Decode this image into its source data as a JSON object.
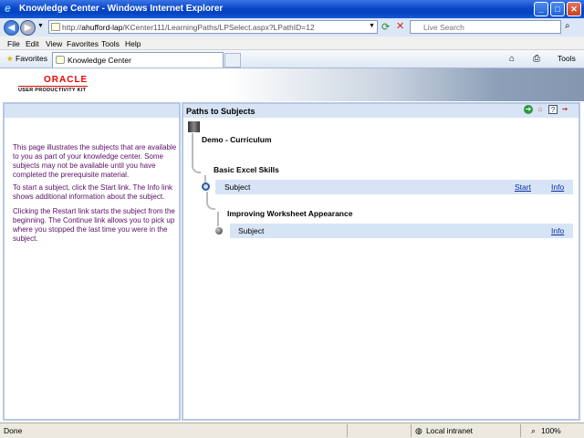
{
  "window": {
    "title": "Knowledge Center - Windows Internet Explorer"
  },
  "addressbar": {
    "url_prefix": "http://",
    "url_host": "ahufford-lap",
    "url_path": "/KCenter111/LearningPaths/LPSelect.aspx?LPathID=12",
    "search_placeholder": "Live Search"
  },
  "menu": [
    "File",
    "Edit",
    "View",
    "Favorites",
    "Tools",
    "Help"
  ],
  "favbar": {
    "favorites": "Favorites",
    "tab": "Knowledge Center",
    "tools": "Tools"
  },
  "banner": {
    "logo": "ORACLE",
    "subtitle": "USER PRODUCTIVITY KIT"
  },
  "left": {
    "p1": "This page illustrates the subjects that are available to you as part of your knowledge center. Some subjects may not be available until you have completed the prerequisite material.",
    "p2": "To start a subject, click the Start link. The Info link shows additional information about the subject.",
    "p3": "Clicking the Restart link starts the subject from the beginning. The Continue link allows you to pick up where you stopped the last time you were in the subject."
  },
  "right": {
    "header": "Paths to Subjects",
    "curriculum": "Demo - Curriculum",
    "sections": [
      {
        "title": "Basic Excel Skills",
        "subject": "Subject",
        "start": "Start",
        "info": "Info"
      },
      {
        "title": "Improving Worksheet Appearance",
        "subject": "Subject",
        "info": "Info"
      }
    ]
  },
  "status": {
    "text": "Done",
    "zone": "Local intranet",
    "zoom": "100%"
  }
}
